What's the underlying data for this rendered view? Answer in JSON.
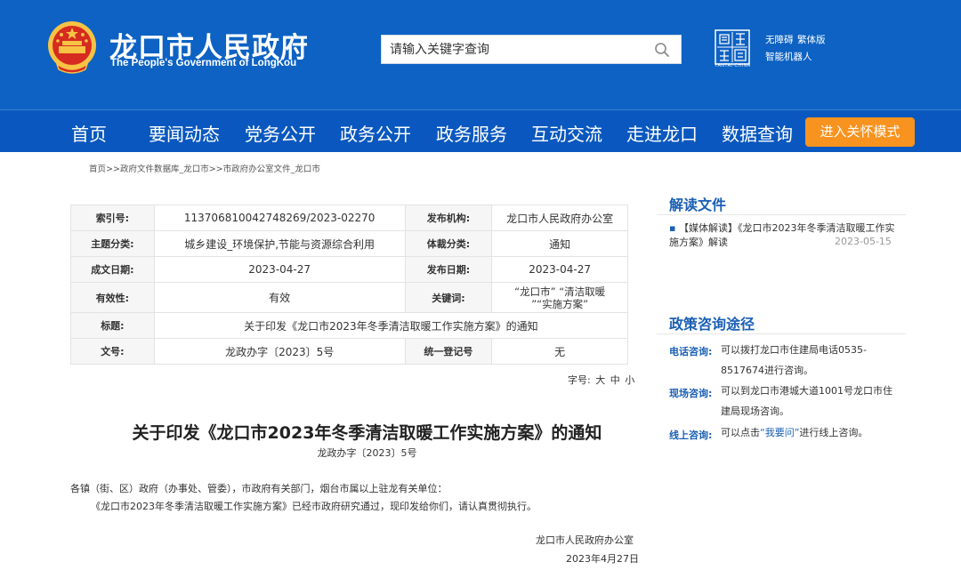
{
  "header": {
    "title": "龙口市人民政府",
    "subtitle": "The People's Government of LongKou",
    "search_placeholder": "请输入关键字查询",
    "yantai_logo_text": "YANTAI·CHINA",
    "links": [
      "无障碍",
      "繁体版",
      "智能机器人"
    ]
  },
  "nav": {
    "items": [
      "首页",
      "要闻动态",
      "党务公开",
      "政务公开",
      "政务服务",
      "互动交流",
      "走进龙口",
      "数据查询"
    ],
    "care_mode": "进入关怀模式"
  },
  "breadcrumb": {
    "items": [
      "首页",
      "政府文件数据库_龙口市",
      "市政府办公室文件_龙口市"
    ],
    "separator": ">>"
  },
  "info": {
    "index_label": "索引号:",
    "index_value": "113706810042748269/2023-02270",
    "issuer_label": "发布机构:",
    "issuer_value": "龙口市人民政府办公室",
    "topic_label": "主题分类:",
    "topic_value": "城乡建设_环境保护,节能与资源综合利用",
    "genre_label": "体裁分类:",
    "genre_value": "通知",
    "created_label": "成文日期:",
    "created_value": "2023-04-27",
    "published_label": "发布日期:",
    "published_value": "2023-04-27",
    "validity_label": "有效性:",
    "validity_value": "有效",
    "keywords_label": "关键词:",
    "keywords_line1": "“龙口市” “清洁取暖",
    "keywords_line2": "”“实施方案”",
    "title_label": "标题:",
    "title_value": "关于印发《龙口市2023年冬季清洁取暖工作实施方案》的通知",
    "docno_label": "文号:",
    "docno_value": "龙政办字〔2023〕5号",
    "regno_label": "统一登记号",
    "regno_value": "无"
  },
  "font_size": {
    "label": "字号:",
    "large": "大",
    "medium": "中",
    "small": "小"
  },
  "document": {
    "title": "关于印发《龙口市2023年冬季清洁取暖工作实施方案》的通知",
    "number": "龙政办字〔2023〕5号",
    "recipients": "各镇（街、区）政府（办事处、管委），市政府有关部门，烟台市属以上驻龙有关单位：",
    "body": "《龙口市2023年冬季清洁取暖工作实施方案》已经市政府研究通过，现印发给你们，请认真贯彻执行。",
    "signer": "龙口市人民政府办公室",
    "date": "2023年4月27日"
  },
  "sidebar": {
    "reading_title": "解读文件",
    "reading_item": "【媒体解读】《龙口市2023年冬季清洁取暖工作实施方案》解读",
    "reading_date": "2023-05-15",
    "consult_title": "政策咨询途径",
    "phone_label": "电话咨询:",
    "phone_text": "可以拨打龙口市住建局电话0535-8517674进行咨询。",
    "site_label": "现场咨询:",
    "site_text": "可以到龙口市港城大道1001号龙口市住建局现场咨询。",
    "online_label": "线上咨询:",
    "online_text_before": "可以点击",
    "online_link": "“我要问”",
    "online_text_after": "进行线上咨询。"
  },
  "colors": {
    "header_blue": "#0d62c3",
    "nav_blue": "#0a58bf",
    "care_orange": "#f7931e",
    "sidebar_title_blue": "#1a5fb4"
  },
  "icons": [
    "national-emblem-icon",
    "search-icon",
    "yantai-logo-icon"
  ]
}
